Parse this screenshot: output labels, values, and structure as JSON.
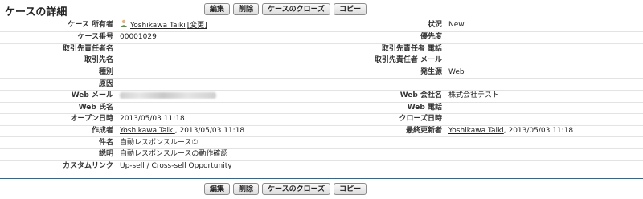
{
  "header": {
    "title": "ケースの詳細"
  },
  "buttons": {
    "edit": "編集",
    "delete": "削除",
    "close_case": "ケースのクローズ",
    "copy": "コピー"
  },
  "fields": {
    "owner": {
      "label": "ケース 所有者",
      "value": "Yoshikawa Taiki",
      "change": "[変更]"
    },
    "status": {
      "label": "状況",
      "value": "New"
    },
    "case_number": {
      "label": "ケース番号",
      "value": "00001029"
    },
    "priority": {
      "label": "優先度",
      "value": ""
    },
    "contact_name": {
      "label": "取引先責任者名",
      "value": ""
    },
    "contact_phone": {
      "label": "取引先責任者 電話",
      "value": ""
    },
    "account_name": {
      "label": "取引先名",
      "value": ""
    },
    "contact_email": {
      "label": "取引先責任者 メール",
      "value": ""
    },
    "type": {
      "label": "種別",
      "value": ""
    },
    "origin": {
      "label": "発生源",
      "value": "Web"
    },
    "reason": {
      "label": "原因",
      "value": ""
    },
    "web_email": {
      "label": "Web メール",
      "value": ""
    },
    "web_company": {
      "label": "Web 会社名",
      "value": "株式会社テスト"
    },
    "web_name": {
      "label": "Web 氏名",
      "value": ""
    },
    "web_phone": {
      "label": "Web 電話",
      "value": ""
    },
    "opened_date": {
      "label": "オープン日時",
      "value": "2013/05/03 11:18"
    },
    "closed_date": {
      "label": "クローズ日時",
      "value": ""
    },
    "created_by": {
      "label": "作成者",
      "user": "Yoshikawa Taiki",
      "date": ", 2013/05/03 11:18"
    },
    "modified_by": {
      "label": "最終更新者",
      "user": "Yoshikawa Taiki",
      "date": ", 2013/05/03 11:18"
    },
    "subject": {
      "label": "件名",
      "value": "自動レスポンスルース①"
    },
    "description": {
      "label": "説明",
      "value": "自動レスポンスルースの動作確認"
    },
    "custom_links": {
      "label": "カスタムリンク",
      "value": "Up-sell / Cross-sell Opportunity"
    }
  },
  "colors": {
    "accent_line": "#1b6eae",
    "row_divider": "#e3e3e3"
  }
}
